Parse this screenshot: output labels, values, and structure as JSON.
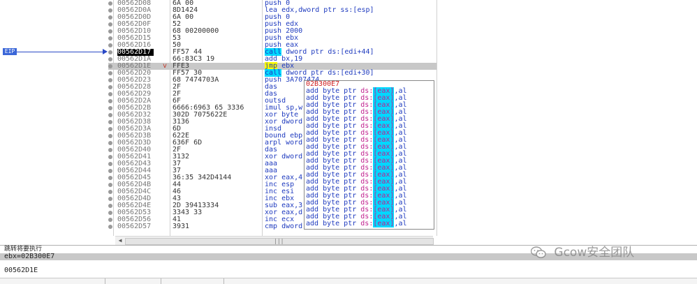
{
  "eip_label": "EIP",
  "rows": [
    {
      "addr": "00562D08",
      "bytes": "6A 00",
      "instr": "push 0",
      "jmp": "",
      "cur": false,
      "sel": false
    },
    {
      "addr": "00562D0A",
      "bytes": "8D1424",
      "instr": "lea edx,dword ptr ss:[esp]",
      "jmp": "",
      "cur": false,
      "sel": false
    },
    {
      "addr": "00562D0D",
      "bytes": "6A 00",
      "instr": "push 0",
      "jmp": "",
      "cur": false,
      "sel": false
    },
    {
      "addr": "00562D0F",
      "bytes": "52",
      "instr": "push edx",
      "jmp": "",
      "cur": false,
      "sel": false
    },
    {
      "addr": "00562D10",
      "bytes": "68 00200000",
      "instr": "push 2000",
      "jmp": "",
      "cur": false,
      "sel": false
    },
    {
      "addr": "00562D15",
      "bytes": "53",
      "instr": "push ebx",
      "jmp": "",
      "cur": false,
      "sel": false
    },
    {
      "addr": "00562D16",
      "bytes": "50",
      "instr": "push eax",
      "jmp": "",
      "cur": false,
      "sel": false
    },
    {
      "addr": "00562D17",
      "bytes": "FF57 44",
      "instr": "call dword ptr ds:[edi+44]",
      "jmp": "",
      "cur": true,
      "sel": false
    },
    {
      "addr": "00562D1A",
      "bytes": "66:83C3 19",
      "instr": "add bx,19",
      "jmp": "",
      "cur": false,
      "sel": false
    },
    {
      "addr": "00562D1E",
      "bytes": "FFE3",
      "instr": "jmp ebx",
      "jmp": "v",
      "cur": false,
      "sel": true
    },
    {
      "addr": "00562D20",
      "bytes": "FF57 30",
      "instr": "call dword ptr ds:[edi+30]",
      "jmp": "",
      "cur": false,
      "sel": false
    },
    {
      "addr": "00562D23",
      "bytes": "68 7474703A",
      "instr": "push 3A707474",
      "jmp": "",
      "cur": false,
      "sel": false
    },
    {
      "addr": "00562D28",
      "bytes": "2F",
      "instr": "das",
      "jmp": "",
      "cur": false,
      "sel": false
    },
    {
      "addr": "00562D29",
      "bytes": "2F",
      "instr": "das",
      "jmp": "",
      "cur": false,
      "sel": false
    },
    {
      "addr": "00562D2A",
      "bytes": "6F",
      "instr": "outsd",
      "jmp": "",
      "cur": false,
      "sel": false
    },
    {
      "addr": "00562D2B",
      "bytes": "6666:6963 65 3336",
      "instr": "imul sp,w",
      "jmp": "",
      "cur": false,
      "sel": false
    },
    {
      "addr": "00562D32",
      "bytes": "302D 7075622E",
      "instr": "xor byte",
      "jmp": "",
      "cur": false,
      "sel": false
    },
    {
      "addr": "00562D38",
      "bytes": "3136",
      "instr": "xor dword",
      "jmp": "",
      "cur": false,
      "sel": false
    },
    {
      "addr": "00562D3A",
      "bytes": "6D",
      "instr": "insd",
      "jmp": "",
      "cur": false,
      "sel": false
    },
    {
      "addr": "00562D3B",
      "bytes": "622E",
      "instr": "bound ebp",
      "jmp": "",
      "cur": false,
      "sel": false
    },
    {
      "addr": "00562D3D",
      "bytes": "636F 6D",
      "instr": "arpl word",
      "jmp": "",
      "cur": false,
      "sel": false
    },
    {
      "addr": "00562D40",
      "bytes": "2F",
      "instr": "das",
      "jmp": "",
      "cur": false,
      "sel": false
    },
    {
      "addr": "00562D41",
      "bytes": "3132",
      "instr": "xor dword",
      "jmp": "",
      "cur": false,
      "sel": false
    },
    {
      "addr": "00562D43",
      "bytes": "37",
      "instr": "aaa",
      "jmp": "",
      "cur": false,
      "sel": false
    },
    {
      "addr": "00562D44",
      "bytes": "37",
      "instr": "aaa",
      "jmp": "",
      "cur": false,
      "sel": false
    },
    {
      "addr": "00562D45",
      "bytes": "36:35 342D4144",
      "instr": "xor eax,4",
      "jmp": "",
      "cur": false,
      "sel": false
    },
    {
      "addr": "00562D4B",
      "bytes": "44",
      "instr": "inc esp",
      "jmp": "",
      "cur": false,
      "sel": false
    },
    {
      "addr": "00562D4C",
      "bytes": "46",
      "instr": "inc esi",
      "jmp": "",
      "cur": false,
      "sel": false
    },
    {
      "addr": "00562D4D",
      "bytes": "43",
      "instr": "inc ebx",
      "jmp": "",
      "cur": false,
      "sel": false
    },
    {
      "addr": "00562D4E",
      "bytes": "2D 39413334",
      "instr": "sub eax,3",
      "jmp": "",
      "cur": false,
      "sel": false
    },
    {
      "addr": "00562D53",
      "bytes": "3343 33",
      "instr": "xor eax,d",
      "jmp": "",
      "cur": false,
      "sel": false
    },
    {
      "addr": "00562D56",
      "bytes": "41",
      "instr": "inc ecx",
      "jmp": "",
      "cur": false,
      "sel": false
    },
    {
      "addr": "00562D57",
      "bytes": "3931",
      "instr": "cmp dword",
      "jmp": "",
      "cur": false,
      "sel": false
    }
  ],
  "popup": {
    "title": "02B300E7",
    "line_prefix": "add byte ptr ",
    "line_seg": "ds:",
    "line_reg": "[eax]",
    "line_suffix": ",al",
    "line_count": 20
  },
  "info": {
    "hint": "跳转将要执行",
    "register": "ebx=02B300E7",
    "address": "00562D1E"
  },
  "watermark": {
    "icon": "wechat-icon",
    "text": "Gcow安全团队"
  }
}
